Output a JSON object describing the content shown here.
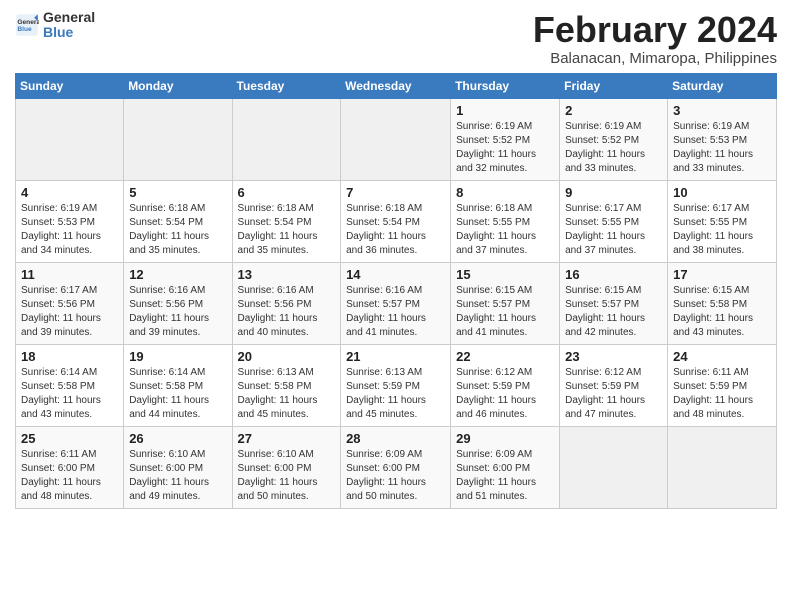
{
  "logo": {
    "general": "General",
    "blue": "Blue"
  },
  "title": "February 2024",
  "subtitle": "Balanacan, Mimaropa, Philippines",
  "days_of_week": [
    "Sunday",
    "Monday",
    "Tuesday",
    "Wednesday",
    "Thursday",
    "Friday",
    "Saturday"
  ],
  "weeks": [
    [
      {
        "day": "",
        "info": ""
      },
      {
        "day": "",
        "info": ""
      },
      {
        "day": "",
        "info": ""
      },
      {
        "day": "",
        "info": ""
      },
      {
        "day": "1",
        "info": "Sunrise: 6:19 AM\nSunset: 5:52 PM\nDaylight: 11 hours\nand 32 minutes."
      },
      {
        "day": "2",
        "info": "Sunrise: 6:19 AM\nSunset: 5:52 PM\nDaylight: 11 hours\nand 33 minutes."
      },
      {
        "day": "3",
        "info": "Sunrise: 6:19 AM\nSunset: 5:53 PM\nDaylight: 11 hours\nand 33 minutes."
      }
    ],
    [
      {
        "day": "4",
        "info": "Sunrise: 6:19 AM\nSunset: 5:53 PM\nDaylight: 11 hours\nand 34 minutes."
      },
      {
        "day": "5",
        "info": "Sunrise: 6:18 AM\nSunset: 5:54 PM\nDaylight: 11 hours\nand 35 minutes."
      },
      {
        "day": "6",
        "info": "Sunrise: 6:18 AM\nSunset: 5:54 PM\nDaylight: 11 hours\nand 35 minutes."
      },
      {
        "day": "7",
        "info": "Sunrise: 6:18 AM\nSunset: 5:54 PM\nDaylight: 11 hours\nand 36 minutes."
      },
      {
        "day": "8",
        "info": "Sunrise: 6:18 AM\nSunset: 5:55 PM\nDaylight: 11 hours\nand 37 minutes."
      },
      {
        "day": "9",
        "info": "Sunrise: 6:17 AM\nSunset: 5:55 PM\nDaylight: 11 hours\nand 37 minutes."
      },
      {
        "day": "10",
        "info": "Sunrise: 6:17 AM\nSunset: 5:55 PM\nDaylight: 11 hours\nand 38 minutes."
      }
    ],
    [
      {
        "day": "11",
        "info": "Sunrise: 6:17 AM\nSunset: 5:56 PM\nDaylight: 11 hours\nand 39 minutes."
      },
      {
        "day": "12",
        "info": "Sunrise: 6:16 AM\nSunset: 5:56 PM\nDaylight: 11 hours\nand 39 minutes."
      },
      {
        "day": "13",
        "info": "Sunrise: 6:16 AM\nSunset: 5:56 PM\nDaylight: 11 hours\nand 40 minutes."
      },
      {
        "day": "14",
        "info": "Sunrise: 6:16 AM\nSunset: 5:57 PM\nDaylight: 11 hours\nand 41 minutes."
      },
      {
        "day": "15",
        "info": "Sunrise: 6:15 AM\nSunset: 5:57 PM\nDaylight: 11 hours\nand 41 minutes."
      },
      {
        "day": "16",
        "info": "Sunrise: 6:15 AM\nSunset: 5:57 PM\nDaylight: 11 hours\nand 42 minutes."
      },
      {
        "day": "17",
        "info": "Sunrise: 6:15 AM\nSunset: 5:58 PM\nDaylight: 11 hours\nand 43 minutes."
      }
    ],
    [
      {
        "day": "18",
        "info": "Sunrise: 6:14 AM\nSunset: 5:58 PM\nDaylight: 11 hours\nand 43 minutes."
      },
      {
        "day": "19",
        "info": "Sunrise: 6:14 AM\nSunset: 5:58 PM\nDaylight: 11 hours\nand 44 minutes."
      },
      {
        "day": "20",
        "info": "Sunrise: 6:13 AM\nSunset: 5:58 PM\nDaylight: 11 hours\nand 45 minutes."
      },
      {
        "day": "21",
        "info": "Sunrise: 6:13 AM\nSunset: 5:59 PM\nDaylight: 11 hours\nand 45 minutes."
      },
      {
        "day": "22",
        "info": "Sunrise: 6:12 AM\nSunset: 5:59 PM\nDaylight: 11 hours\nand 46 minutes."
      },
      {
        "day": "23",
        "info": "Sunrise: 6:12 AM\nSunset: 5:59 PM\nDaylight: 11 hours\nand 47 minutes."
      },
      {
        "day": "24",
        "info": "Sunrise: 6:11 AM\nSunset: 5:59 PM\nDaylight: 11 hours\nand 48 minutes."
      }
    ],
    [
      {
        "day": "25",
        "info": "Sunrise: 6:11 AM\nSunset: 6:00 PM\nDaylight: 11 hours\nand 48 minutes."
      },
      {
        "day": "26",
        "info": "Sunrise: 6:10 AM\nSunset: 6:00 PM\nDaylight: 11 hours\nand 49 minutes."
      },
      {
        "day": "27",
        "info": "Sunrise: 6:10 AM\nSunset: 6:00 PM\nDaylight: 11 hours\nand 50 minutes."
      },
      {
        "day": "28",
        "info": "Sunrise: 6:09 AM\nSunset: 6:00 PM\nDaylight: 11 hours\nand 50 minutes."
      },
      {
        "day": "29",
        "info": "Sunrise: 6:09 AM\nSunset: 6:00 PM\nDaylight: 11 hours\nand 51 minutes."
      },
      {
        "day": "",
        "info": ""
      },
      {
        "day": "",
        "info": ""
      }
    ]
  ]
}
